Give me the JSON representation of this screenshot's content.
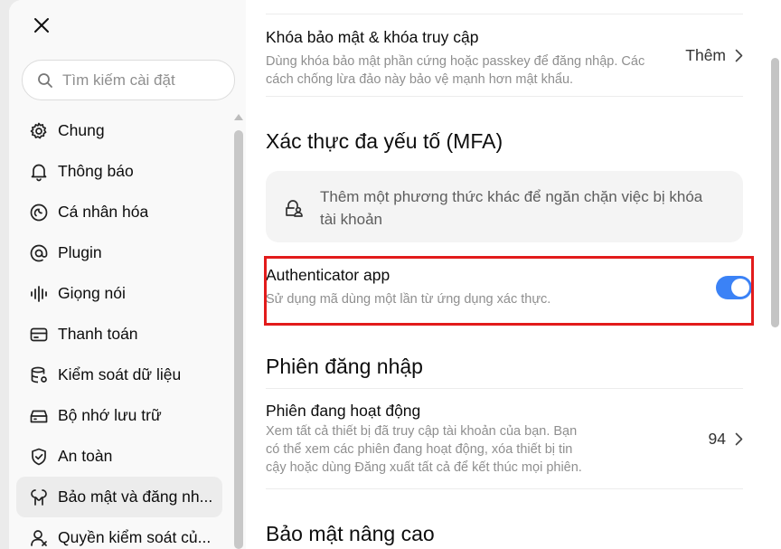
{
  "sidebar": {
    "search_placeholder": "Tìm kiếm cài đặt",
    "items": [
      {
        "label": "Chung",
        "icon": "gear-icon"
      },
      {
        "label": "Thông báo",
        "icon": "bell-icon"
      },
      {
        "label": "Cá nhân hóa",
        "icon": "personalization-icon"
      },
      {
        "label": "Plugin",
        "icon": "at-sign-icon"
      },
      {
        "label": "Giọng nói",
        "icon": "voice-wave-icon"
      },
      {
        "label": "Thanh toán",
        "icon": "credit-card-icon"
      },
      {
        "label": "Kiểm soát dữ liệu",
        "icon": "database-icon"
      },
      {
        "label": "Bộ nhớ lưu trữ",
        "icon": "storage-icon"
      },
      {
        "label": "An toàn",
        "icon": "shield-icon"
      },
      {
        "label": "Bảo mật và đăng nh...",
        "icon": "security-icon",
        "active": true
      },
      {
        "label": "Quyền kiểm soát củ...",
        "icon": "user-icon"
      }
    ]
  },
  "main": {
    "passkeys": {
      "title": "Khóa bảo mật & khóa truy cập",
      "desc_line1": "Dùng khóa bảo mật phần cứng hoặc passkey để đăng nhập. Các",
      "desc_line2": "cách chống lừa đảo này bảo vệ mạnh hơn mật khẩu.",
      "action": "Thêm"
    },
    "mfa": {
      "heading": "Xác thực đa yếu tố (MFA)",
      "info_line1": "Thêm một phương thức khác để ngăn chặn việc bị khóa",
      "info_line2": "tài khoản",
      "authenticator": {
        "title": "Authenticator app",
        "desc": "Sử dụng mã dùng một lần từ ứng dụng xác thực.",
        "enabled": true
      }
    },
    "sessions": {
      "heading": "Phiên đăng nhập",
      "active": {
        "title": "Phiên đang hoạt động",
        "desc_line1": "Xem tất cả thiết bị đã truy cập tài khoản của bạn. Bạn",
        "desc_line2": "có thể xem các phiên đang hoạt động, xóa thiết bị tin",
        "desc_line3": "cậy hoặc dùng Đăng xuất tất cả để kết thúc mọi phiên.",
        "count": "94"
      }
    },
    "advanced": {
      "heading": "Bảo mật nâng cao"
    }
  },
  "colors": {
    "accent": "#3b82f6",
    "highlight": "#e21b1b",
    "sidebar_bg": "#f9f9f9",
    "active_item_bg": "#ececec"
  }
}
